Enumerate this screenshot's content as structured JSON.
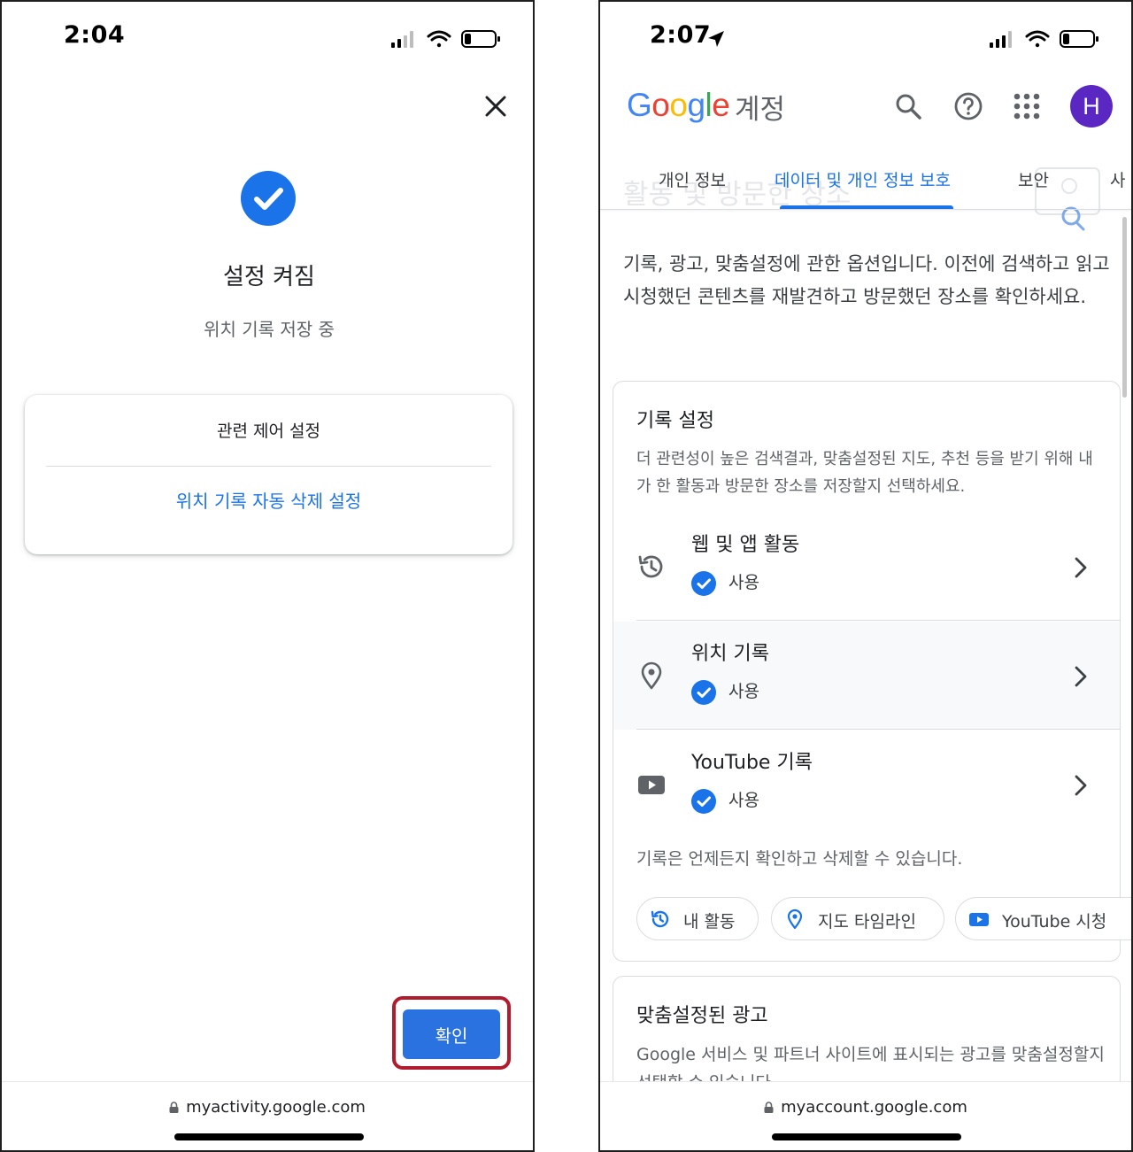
{
  "left_screen": {
    "status": {
      "time": "2:04"
    },
    "dialog": {
      "title": "설정 켜짐",
      "subtitle": "위치 기록 저장 중",
      "related_controls_title": "관련 제어 설정",
      "auto_delete_link": "위치 기록 자동 삭제 설정",
      "confirm_label": "확인"
    },
    "url": "myactivity.google.com"
  },
  "right_screen": {
    "status": {
      "time": "2:07"
    },
    "header": {
      "brand_letters": [
        {
          "ch": "G",
          "color": "#4285F4"
        },
        {
          "ch": "o",
          "color": "#EA4335"
        },
        {
          "ch": "o",
          "color": "#FBBC05"
        },
        {
          "ch": "g",
          "color": "#4285F4"
        },
        {
          "ch": "l",
          "color": "#34A853"
        },
        {
          "ch": "e",
          "color": "#EA4335"
        }
      ],
      "product": "계정",
      "avatar_initial": "H"
    },
    "background_heading": "활동 및 방문한 장소",
    "tabs": [
      {
        "label": "개인 정보"
      },
      {
        "label": "데이터 및 개인 정보 보호"
      },
      {
        "label": "보안"
      },
      {
        "label": "사"
      }
    ],
    "intro": "기록, 광고, 맞춤설정에 관한 옵션입니다. 이전에 검색하고 읽고 시청했던 콘텐츠를 재발견하고 방문했던 장소를 확인하세요.",
    "history_settings": {
      "title": "기록 설정",
      "description": "더 관련성이 높은 검색결과, 맞춤설정된 지도, 추천 등을 받기 위해 내가 한 활동과 방문한 장소를 저장할지 선택하세요.",
      "items": [
        {
          "title": "웹 및 앱 활동",
          "status": "사용",
          "icon": "history-icon"
        },
        {
          "title": "위치 기록",
          "status": "사용",
          "icon": "location-pin-icon"
        },
        {
          "title": "YouTube 기록",
          "status": "사용",
          "icon": "youtube-icon"
        }
      ],
      "footer_note": "기록은 언제든지 확인하고 삭제할 수 있습니다.",
      "chips": [
        {
          "label": "내 활동",
          "icon": "history-icon"
        },
        {
          "label": "지도 타임라인",
          "icon": "location-pin-icon"
        },
        {
          "label": "YouTube 시청",
          "icon": "youtube-icon"
        }
      ]
    },
    "personalized_ads": {
      "title": "맞춤설정된 광고",
      "description": "Google 서비스 및 파트너 사이트에 표시되는 광고를 맞춤설정할지 선택할 수 있습니다."
    },
    "url": "myaccount.google.com"
  },
  "colors": {
    "accent_blue": "#1a73e8",
    "highlight_red": "#b01c2e",
    "avatar_purple": "#5a27c3"
  }
}
